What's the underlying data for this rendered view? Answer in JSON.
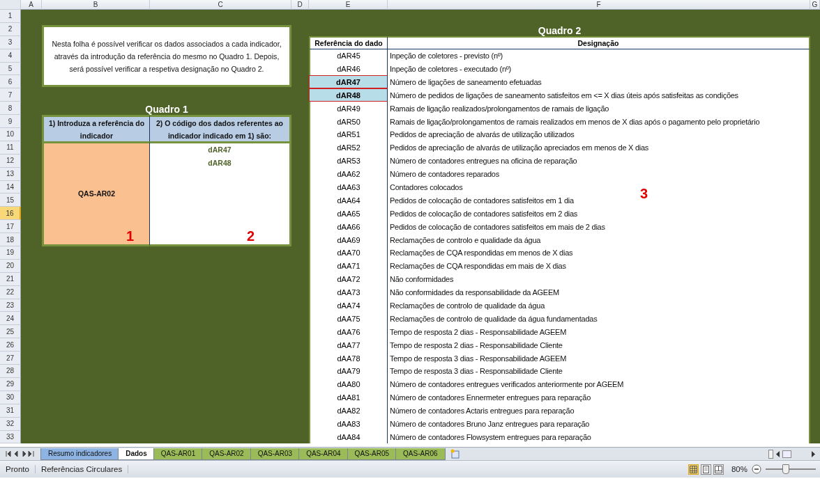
{
  "columns": [
    "A",
    "B",
    "C",
    "D",
    "E",
    "F",
    "G"
  ],
  "rows": [
    {
      "label": "1",
      "selected": false
    },
    {
      "label": "2",
      "selected": false
    },
    {
      "label": "3",
      "selected": false
    },
    {
      "label": "4",
      "selected": false
    },
    {
      "label": "5",
      "selected": false
    },
    {
      "label": "6",
      "selected": false
    },
    {
      "label": "7",
      "selected": false
    },
    {
      "label": "8",
      "selected": false
    },
    {
      "label": "9",
      "selected": false
    },
    {
      "label": "10",
      "selected": false
    },
    {
      "label": "11",
      "selected": false
    },
    {
      "label": "12",
      "selected": false
    },
    {
      "label": "13",
      "selected": false
    },
    {
      "label": "14",
      "selected": false
    },
    {
      "label": "15",
      "selected": false
    },
    {
      "label": "16",
      "selected": true
    },
    {
      "label": "17",
      "selected": false
    },
    {
      "label": "18",
      "selected": false
    },
    {
      "label": "19",
      "selected": false
    },
    {
      "label": "20",
      "selected": false
    },
    {
      "label": "21",
      "selected": false
    },
    {
      "label": "22",
      "selected": false
    },
    {
      "label": "23",
      "selected": false
    },
    {
      "label": "24",
      "selected": false
    },
    {
      "label": "25",
      "selected": false
    },
    {
      "label": "26",
      "selected": false
    },
    {
      "label": "27",
      "selected": false
    },
    {
      "label": "28",
      "selected": false
    },
    {
      "label": "29",
      "selected": false
    },
    {
      "label": "30",
      "selected": false
    },
    {
      "label": "31",
      "selected": false
    },
    {
      "label": "32",
      "selected": false
    },
    {
      "label": "33",
      "selected": false
    }
  ],
  "instruction": "Nesta folha é possível verificar os dados associados a cada indicador, através da introdução da referência do mesmo no Quadro 1. Depois, será possível verificar a respetiva designação no Quadro 2.",
  "quadro1": {
    "title": "Quadro 1",
    "headers": [
      "1) Introduza a referência do indicador",
      "2) O código dos dados referentes ao indicador indicado em 1) são:"
    ],
    "reference": "QAS-AR02",
    "codes": [
      "dAR47",
      "dAR48"
    ],
    "markers": [
      "1",
      "2"
    ]
  },
  "quadro2": {
    "title": "Quadro 2",
    "headers": [
      "Referência do dado",
      "Designação"
    ],
    "marker": "3",
    "rows": [
      {
        "ref": "dAR45",
        "designation": "Inpeção de coletores - previsto (nº)",
        "highlighted": false
      },
      {
        "ref": "dAR46",
        "designation": "Inpeção de coletores - executado (nº)",
        "highlighted": false
      },
      {
        "ref": "dAR47",
        "designation": "Número de ligações de saneamento efetuadas",
        "highlighted": true
      },
      {
        "ref": "dAR48",
        "designation": "Número de pedidos de ligações de saneamento satisfeitos em <= X dias úteis após satisfeitas as condições",
        "highlighted": true
      },
      {
        "ref": "dAR49",
        "designation": "Ramais de ligação realizados/prolongamentos de ramais de ligação",
        "highlighted": false
      },
      {
        "ref": "dAR50",
        "designation": "Ramais de ligação/prolongamentos de ramais realizados em menos de X dias após o pagamento pelo proprietário",
        "highlighted": false
      },
      {
        "ref": "dAR51",
        "designation": "Pedidos de apreciação de alvarás de utilização utilizados",
        "highlighted": false
      },
      {
        "ref": "dAR52",
        "designation": "Pedidos de apreciação de alvarás de utilização apreciados em menos de X dias",
        "highlighted": false
      },
      {
        "ref": "dAR53",
        "designation": "Número de contadores entregues na oficina de reparação",
        "highlighted": false
      },
      {
        "ref": "dAA62",
        "designation": "Número de contadores reparados",
        "highlighted": false
      },
      {
        "ref": "dAA63",
        "designation": "Contadores colocados",
        "highlighted": false
      },
      {
        "ref": "dAA64",
        "designation": "Pedidos de colocação de contadores satisfeitos em 1 dia",
        "highlighted": false
      },
      {
        "ref": "dAA65",
        "designation": "Pedidos de colocação de contadores satisfeitos em 2 dias",
        "highlighted": false
      },
      {
        "ref": "dAA66",
        "designation": "Pedidos de colocação de contadores satisfeitos em mais de 2 dias",
        "highlighted": false
      },
      {
        "ref": "dAA69",
        "designation": "Reclamações de controlo e qualidade da água",
        "highlighted": false
      },
      {
        "ref": "dAA70",
        "designation": "Reclamações de CQA respondidas em menos de X dias",
        "highlighted": false
      },
      {
        "ref": "dAA71",
        "designation": "Reclamações de CQA respondidas em mais de X dias",
        "highlighted": false
      },
      {
        "ref": "dAA72",
        "designation": "Não conformidades",
        "highlighted": false
      },
      {
        "ref": "dAA73",
        "designation": "Não conformidades da responsabilidade da AGEEM",
        "highlighted": false
      },
      {
        "ref": "dAA74",
        "designation": "Reclamações de controlo de qualidade da água",
        "highlighted": false
      },
      {
        "ref": "dAA75",
        "designation": "Reclamações de controlo de qualidade da água fundamentadas",
        "highlighted": false
      },
      {
        "ref": "dAA76",
        "designation": "Tempo de resposta 2 dias - Responsabilidade AGEEM",
        "highlighted": false
      },
      {
        "ref": "dAA77",
        "designation": "Tempo de resposta 2 dias - Responsabilidade Cliente",
        "highlighted": false
      },
      {
        "ref": "dAA78",
        "designation": "Tempo de resposta 3 dias - Responsabilidade AGEEM",
        "highlighted": false
      },
      {
        "ref": "dAA79",
        "designation": "Tempo de resposta 3 dias - Responsabilidade Cliente",
        "highlighted": false
      },
      {
        "ref": "dAA80",
        "designation": "Número de contadores entregues verificados anteriormente por AGEEM",
        "highlighted": false
      },
      {
        "ref": "dAA81",
        "designation": "Número de contadores Ennermeter entregues para reparação",
        "highlighted": false
      },
      {
        "ref": "dAA82",
        "designation": "Número de contadores Actaris entregues para reparação",
        "highlighted": false
      },
      {
        "ref": "dAA83",
        "designation": "Número de contadores Bruno Janz entregues para reparação",
        "highlighted": false
      },
      {
        "ref": "dAA84",
        "designation": "Número de contadores Flowsystem entregues para reparação",
        "highlighted": false
      }
    ]
  },
  "sheet_tabs": [
    {
      "label": "Resumo indicadores",
      "selected": false,
      "color": "#8db4e2"
    },
    {
      "label": "Dados",
      "selected": true
    },
    {
      "label": "QAS-AR01",
      "selected": false,
      "color": "#9bbb59"
    },
    {
      "label": "QAS-AR02",
      "selected": false,
      "color": "#9bbb59"
    },
    {
      "label": "QAS-AR03",
      "selected": false,
      "color": "#9bbb59"
    },
    {
      "label": "QAS-AR04",
      "selected": false,
      "color": "#9bbb59"
    },
    {
      "label": "QAS-AR05",
      "selected": false,
      "color": "#9bbb59"
    },
    {
      "label": "QAS-AR06",
      "selected": false,
      "color": "#9bbb59"
    }
  ],
  "status_bar": {
    "items": [
      "Pronto",
      "Referências Circulares"
    ],
    "view_buttons": [
      {
        "kind": "normal",
        "selected": true
      },
      {
        "kind": "page_layout",
        "selected": false
      },
      {
        "kind": "page_break",
        "selected": false
      }
    ],
    "zoom": "80%",
    "zoom_slider": {
      "level": 0.4
    }
  }
}
